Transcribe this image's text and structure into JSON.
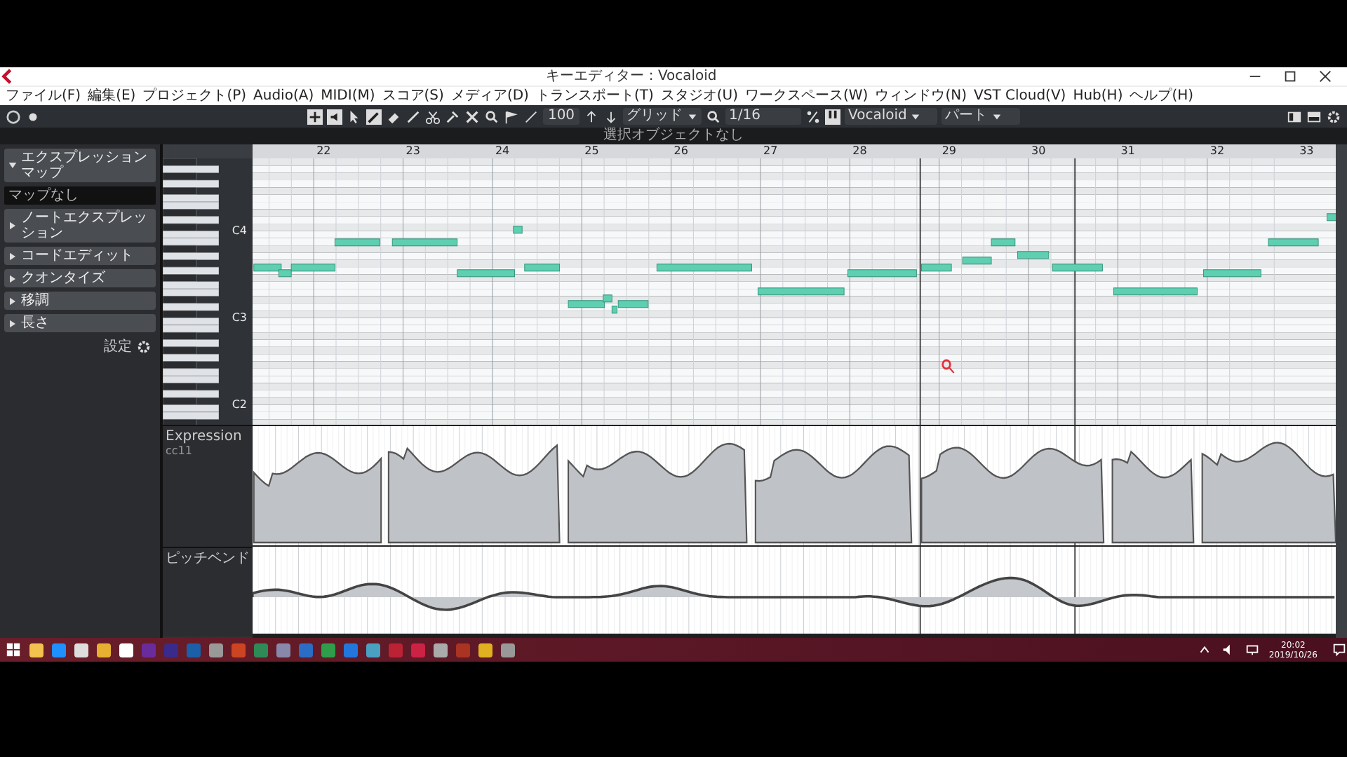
{
  "window": {
    "title": "キーエディター : Vocaloid"
  },
  "menu": [
    "ファイル(F)",
    "編集(E)",
    "プロジェクト(P)",
    "Audio(A)",
    "MIDI(M)",
    "スコア(S)",
    "メディア(D)",
    "トランスポート(T)",
    "スタジオ(U)",
    "ワークスペース(W)",
    "ウィンドウ(N)",
    "VST Cloud(V)",
    "Hub(H)",
    "ヘルプ(H)"
  ],
  "toolbar": {
    "velocity": "100",
    "snap_mode": "グリッド",
    "quantize": "1/16",
    "instrument": "Vocaloid",
    "display": "パート"
  },
  "info_line": "選択オブジェクトなし",
  "inspector": {
    "sections": [
      {
        "label": "エクスプレッションマップ",
        "expanded": true,
        "field": "マップなし"
      },
      {
        "label": "ノートエクスプレッション",
        "expanded": false
      },
      {
        "label": "コードエディット",
        "expanded": false
      },
      {
        "label": "クオンタイズ",
        "expanded": false
      },
      {
        "label": "移調",
        "expanded": false
      },
      {
        "label": "長さ",
        "expanded": false
      }
    ],
    "settings": "設定"
  },
  "ruler": {
    "bars": [
      "22",
      "23",
      "24",
      "25",
      "26",
      "27",
      "28",
      "29",
      "30",
      "31",
      "32",
      "33"
    ]
  },
  "keyboard": {
    "labels": [
      "C4",
      "C3",
      "C2"
    ]
  },
  "lanes": [
    {
      "kind": "expression",
      "label": "Expression",
      "sublabel": "cc11"
    },
    {
      "kind": "pitchbend",
      "label": "ピッチベンド"
    }
  ],
  "taskbar": {
    "time": "20:02",
    "date": "2019/10/26"
  }
}
